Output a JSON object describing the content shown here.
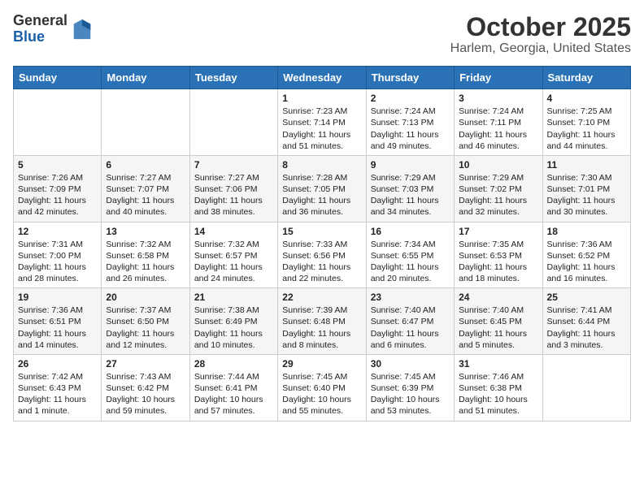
{
  "header": {
    "logo_general": "General",
    "logo_blue": "Blue",
    "title": "October 2025",
    "subtitle": "Harlem, Georgia, United States"
  },
  "days_of_week": [
    "Sunday",
    "Monday",
    "Tuesday",
    "Wednesday",
    "Thursday",
    "Friday",
    "Saturday"
  ],
  "weeks": [
    [
      {
        "day": "",
        "content": ""
      },
      {
        "day": "",
        "content": ""
      },
      {
        "day": "",
        "content": ""
      },
      {
        "day": "1",
        "content": "Sunrise: 7:23 AM\nSunset: 7:14 PM\nDaylight: 11 hours and 51 minutes."
      },
      {
        "day": "2",
        "content": "Sunrise: 7:24 AM\nSunset: 7:13 PM\nDaylight: 11 hours and 49 minutes."
      },
      {
        "day": "3",
        "content": "Sunrise: 7:24 AM\nSunset: 7:11 PM\nDaylight: 11 hours and 46 minutes."
      },
      {
        "day": "4",
        "content": "Sunrise: 7:25 AM\nSunset: 7:10 PM\nDaylight: 11 hours and 44 minutes."
      }
    ],
    [
      {
        "day": "5",
        "content": "Sunrise: 7:26 AM\nSunset: 7:09 PM\nDaylight: 11 hours and 42 minutes."
      },
      {
        "day": "6",
        "content": "Sunrise: 7:27 AM\nSunset: 7:07 PM\nDaylight: 11 hours and 40 minutes."
      },
      {
        "day": "7",
        "content": "Sunrise: 7:27 AM\nSunset: 7:06 PM\nDaylight: 11 hours and 38 minutes."
      },
      {
        "day": "8",
        "content": "Sunrise: 7:28 AM\nSunset: 7:05 PM\nDaylight: 11 hours and 36 minutes."
      },
      {
        "day": "9",
        "content": "Sunrise: 7:29 AM\nSunset: 7:03 PM\nDaylight: 11 hours and 34 minutes."
      },
      {
        "day": "10",
        "content": "Sunrise: 7:29 AM\nSunset: 7:02 PM\nDaylight: 11 hours and 32 minutes."
      },
      {
        "day": "11",
        "content": "Sunrise: 7:30 AM\nSunset: 7:01 PM\nDaylight: 11 hours and 30 minutes."
      }
    ],
    [
      {
        "day": "12",
        "content": "Sunrise: 7:31 AM\nSunset: 7:00 PM\nDaylight: 11 hours and 28 minutes."
      },
      {
        "day": "13",
        "content": "Sunrise: 7:32 AM\nSunset: 6:58 PM\nDaylight: 11 hours and 26 minutes."
      },
      {
        "day": "14",
        "content": "Sunrise: 7:32 AM\nSunset: 6:57 PM\nDaylight: 11 hours and 24 minutes."
      },
      {
        "day": "15",
        "content": "Sunrise: 7:33 AM\nSunset: 6:56 PM\nDaylight: 11 hours and 22 minutes."
      },
      {
        "day": "16",
        "content": "Sunrise: 7:34 AM\nSunset: 6:55 PM\nDaylight: 11 hours and 20 minutes."
      },
      {
        "day": "17",
        "content": "Sunrise: 7:35 AM\nSunset: 6:53 PM\nDaylight: 11 hours and 18 minutes."
      },
      {
        "day": "18",
        "content": "Sunrise: 7:36 AM\nSunset: 6:52 PM\nDaylight: 11 hours and 16 minutes."
      }
    ],
    [
      {
        "day": "19",
        "content": "Sunrise: 7:36 AM\nSunset: 6:51 PM\nDaylight: 11 hours and 14 minutes."
      },
      {
        "day": "20",
        "content": "Sunrise: 7:37 AM\nSunset: 6:50 PM\nDaylight: 11 hours and 12 minutes."
      },
      {
        "day": "21",
        "content": "Sunrise: 7:38 AM\nSunset: 6:49 PM\nDaylight: 11 hours and 10 minutes."
      },
      {
        "day": "22",
        "content": "Sunrise: 7:39 AM\nSunset: 6:48 PM\nDaylight: 11 hours and 8 minutes."
      },
      {
        "day": "23",
        "content": "Sunrise: 7:40 AM\nSunset: 6:47 PM\nDaylight: 11 hours and 6 minutes."
      },
      {
        "day": "24",
        "content": "Sunrise: 7:40 AM\nSunset: 6:45 PM\nDaylight: 11 hours and 5 minutes."
      },
      {
        "day": "25",
        "content": "Sunrise: 7:41 AM\nSunset: 6:44 PM\nDaylight: 11 hours and 3 minutes."
      }
    ],
    [
      {
        "day": "26",
        "content": "Sunrise: 7:42 AM\nSunset: 6:43 PM\nDaylight: 11 hours and 1 minute."
      },
      {
        "day": "27",
        "content": "Sunrise: 7:43 AM\nSunset: 6:42 PM\nDaylight: 10 hours and 59 minutes."
      },
      {
        "day": "28",
        "content": "Sunrise: 7:44 AM\nSunset: 6:41 PM\nDaylight: 10 hours and 57 minutes."
      },
      {
        "day": "29",
        "content": "Sunrise: 7:45 AM\nSunset: 6:40 PM\nDaylight: 10 hours and 55 minutes."
      },
      {
        "day": "30",
        "content": "Sunrise: 7:45 AM\nSunset: 6:39 PM\nDaylight: 10 hours and 53 minutes."
      },
      {
        "day": "31",
        "content": "Sunrise: 7:46 AM\nSunset: 6:38 PM\nDaylight: 10 hours and 51 minutes."
      },
      {
        "day": "",
        "content": ""
      }
    ]
  ]
}
